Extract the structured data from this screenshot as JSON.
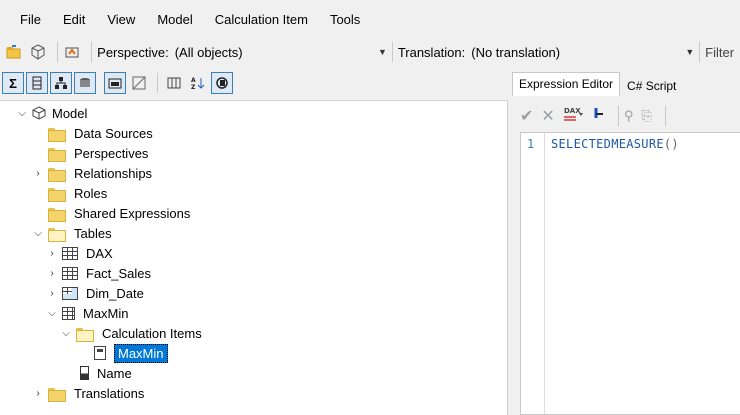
{
  "menu": [
    "File",
    "Edit",
    "View",
    "Model",
    "Calculation Item",
    "Tools"
  ],
  "toolbar": {
    "perspective_label": "Perspective:",
    "perspective_value": "(All objects)",
    "translation_label": "Translation:",
    "translation_value": "(No translation)",
    "filter_label": "Filter"
  },
  "tree": {
    "model": "Model",
    "data_sources": "Data Sources",
    "perspectives": "Perspectives",
    "relationships": "Relationships",
    "roles": "Roles",
    "shared_expressions": "Shared Expressions",
    "tables": "Tables",
    "dax": "DAX",
    "fact_sales": "Fact_Sales",
    "dim_date": "Dim_Date",
    "maxmin": "MaxMin",
    "calculation_items": "Calculation Items",
    "maxmin_item": "MaxMin",
    "name": "Name",
    "translations": "Translations"
  },
  "editor": {
    "tab_expression": "Expression Editor",
    "tab_csharp": "C# Script",
    "line_number": "1",
    "code_fn": "SELECTEDMEASURE",
    "code_parens": "()"
  },
  "colors": {
    "selection": "#0078d7",
    "folder": "#f4d36b",
    "code": "#1f57a4"
  }
}
